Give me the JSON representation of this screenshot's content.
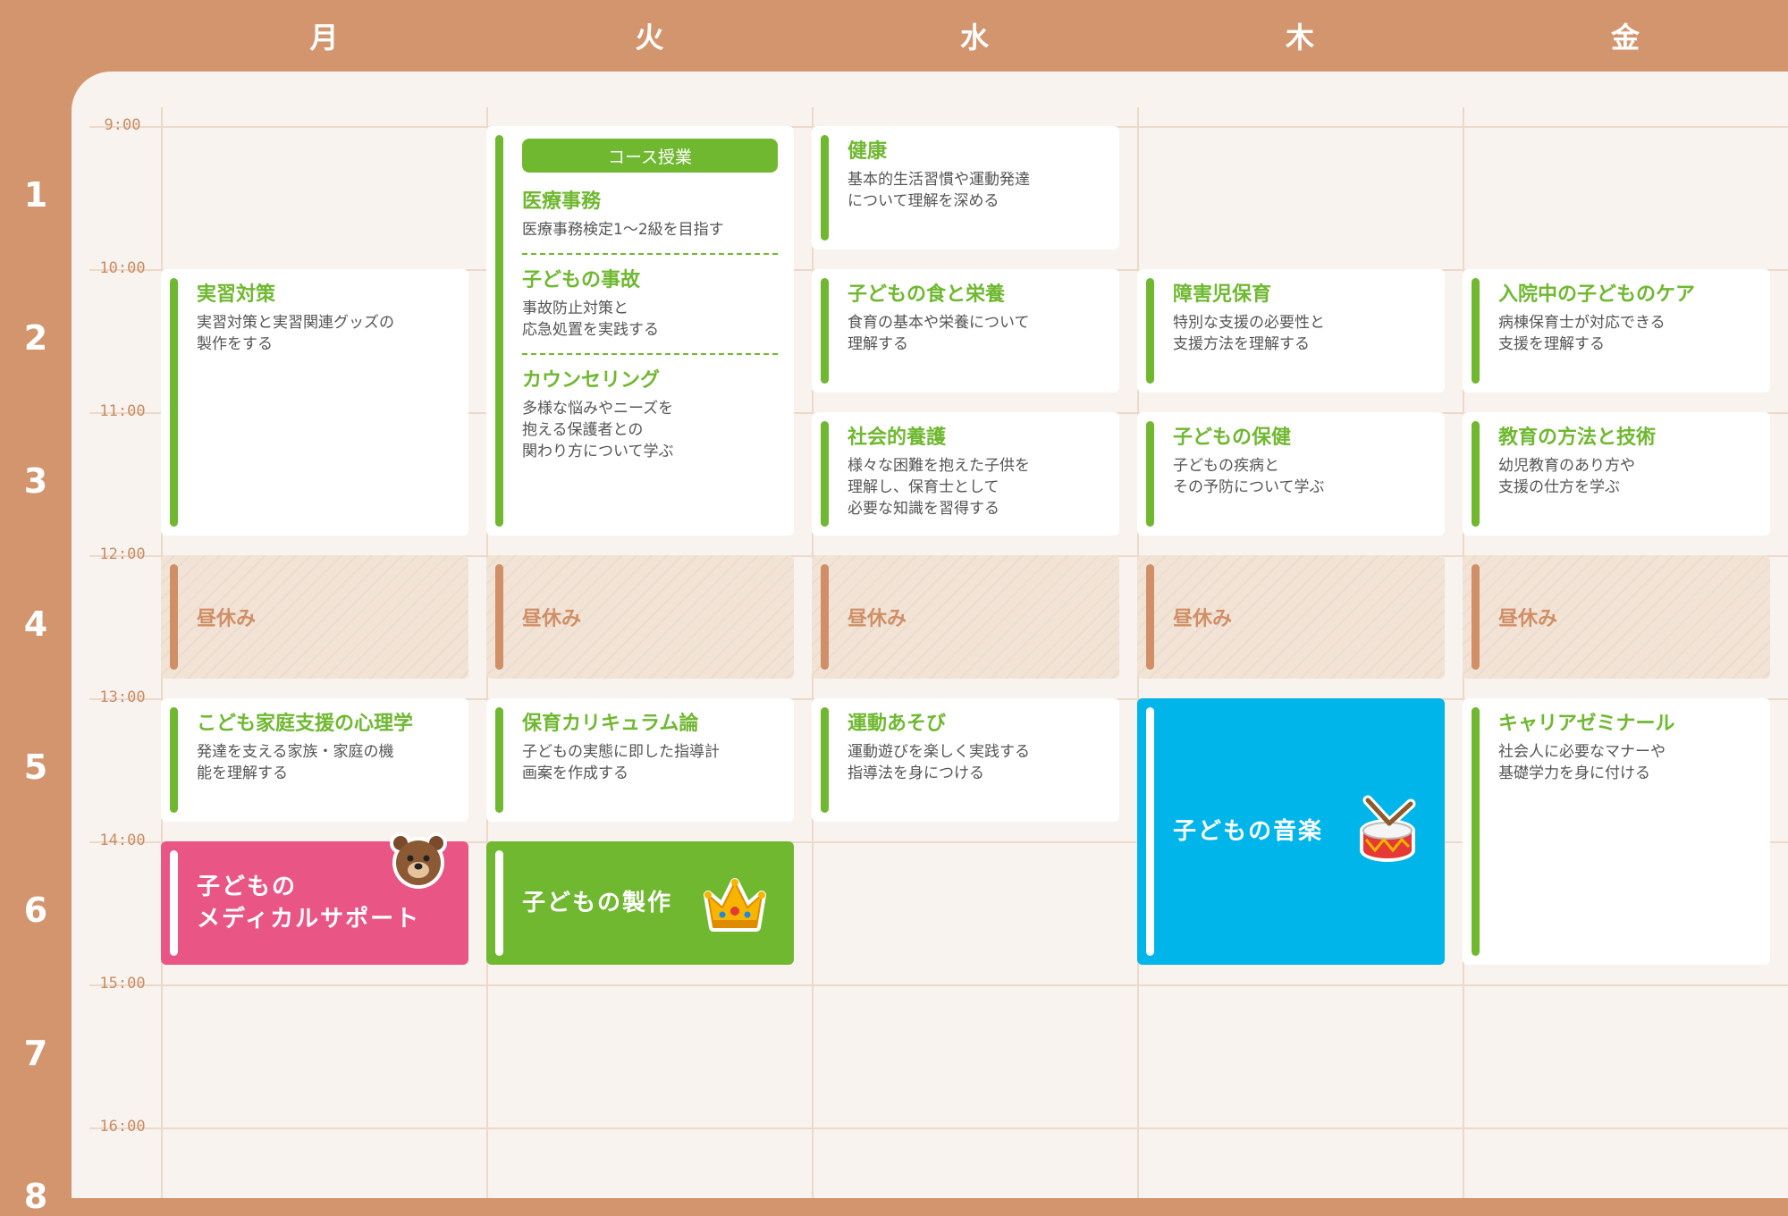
{
  "days": [
    "月",
    "火",
    "水",
    "木",
    "金"
  ],
  "periods": [
    "1",
    "2",
    "3",
    "4",
    "5",
    "6",
    "7",
    "8"
  ],
  "times": [
    "9:00",
    "10:00",
    "11:00",
    "12:00",
    "13:00",
    "14:00",
    "15:00",
    "16:00"
  ],
  "lunch_label": "昼休み",
  "mon": {
    "c1": {
      "title": "実習対策",
      "desc": "実習対策と実習関連グッズの\n製作をする"
    },
    "c2": {
      "title": "こども家庭支援の心理学",
      "desc": "発達を支える家族・家庭の機\n能を理解する"
    },
    "f1": {
      "title": "子どもの\nメディカルサポート",
      "icon": "bear-icon",
      "color": "#e95585"
    }
  },
  "tue": {
    "course_badge": "コース授業",
    "s1": {
      "title": "医療事務",
      "desc": "医療事務検定1～2級を目指す"
    },
    "s2": {
      "title": "子どもの事故",
      "desc": "事故防止対策と\n応急処置を実践する"
    },
    "s3": {
      "title": "カウンセリング",
      "desc": "多様な悩みやニーズを\n抱える保護者との\n関わり方について学ぶ"
    },
    "c2": {
      "title": "保育カリキュラム論",
      "desc": "子どもの実態に即した指導計\n画案を作成する"
    },
    "f1": {
      "title": "子どもの製作",
      "icon": "crown-icon",
      "color": "#6fb830"
    }
  },
  "wed": {
    "c1": {
      "title": "健康",
      "desc": "基本的生活習慣や運動発達\nについて理解を深める"
    },
    "c2": {
      "title": "子どもの食と栄養",
      "desc": "食育の基本や栄養について\n理解する"
    },
    "c3": {
      "title": "社会的養護",
      "desc": "様々な困難を抱えた子供を\n理解し、保育士として\n必要な知識を習得する"
    },
    "c4": {
      "title": "運動あそび",
      "desc": "運動遊びを楽しく実践する\n指導法を身につける"
    }
  },
  "thu": {
    "c1": {
      "title": "障害児保育",
      "desc": "特別な支援の必要性と\n支援方法を理解する"
    },
    "c2": {
      "title": "子どもの保健",
      "desc": "子どもの疾病と\nその予防について学ぶ"
    },
    "f1": {
      "title": "子どもの音楽",
      "icon": "drum-icon",
      "color": "#00b5e9"
    }
  },
  "fri": {
    "c1": {
      "title": "入院中の子どものケア",
      "desc": "病棟保育士が対応できる\n支援を理解する"
    },
    "c2": {
      "title": "教育の方法と技術",
      "desc": "幼児教育のあり方や\n支援の仕方を学ぶ"
    },
    "c3": {
      "title": "キャリアゼミナール",
      "desc": "社会人に必要なマナーや\n基礎学力を身に付ける"
    }
  },
  "colors": {
    "accent_green": "#6fb830",
    "header_brown": "#d3956d",
    "lunch_brown": "#d08f67",
    "medical_pink": "#e95585",
    "music_blue": "#00b5e9",
    "board_bg": "#f8f3ee"
  }
}
